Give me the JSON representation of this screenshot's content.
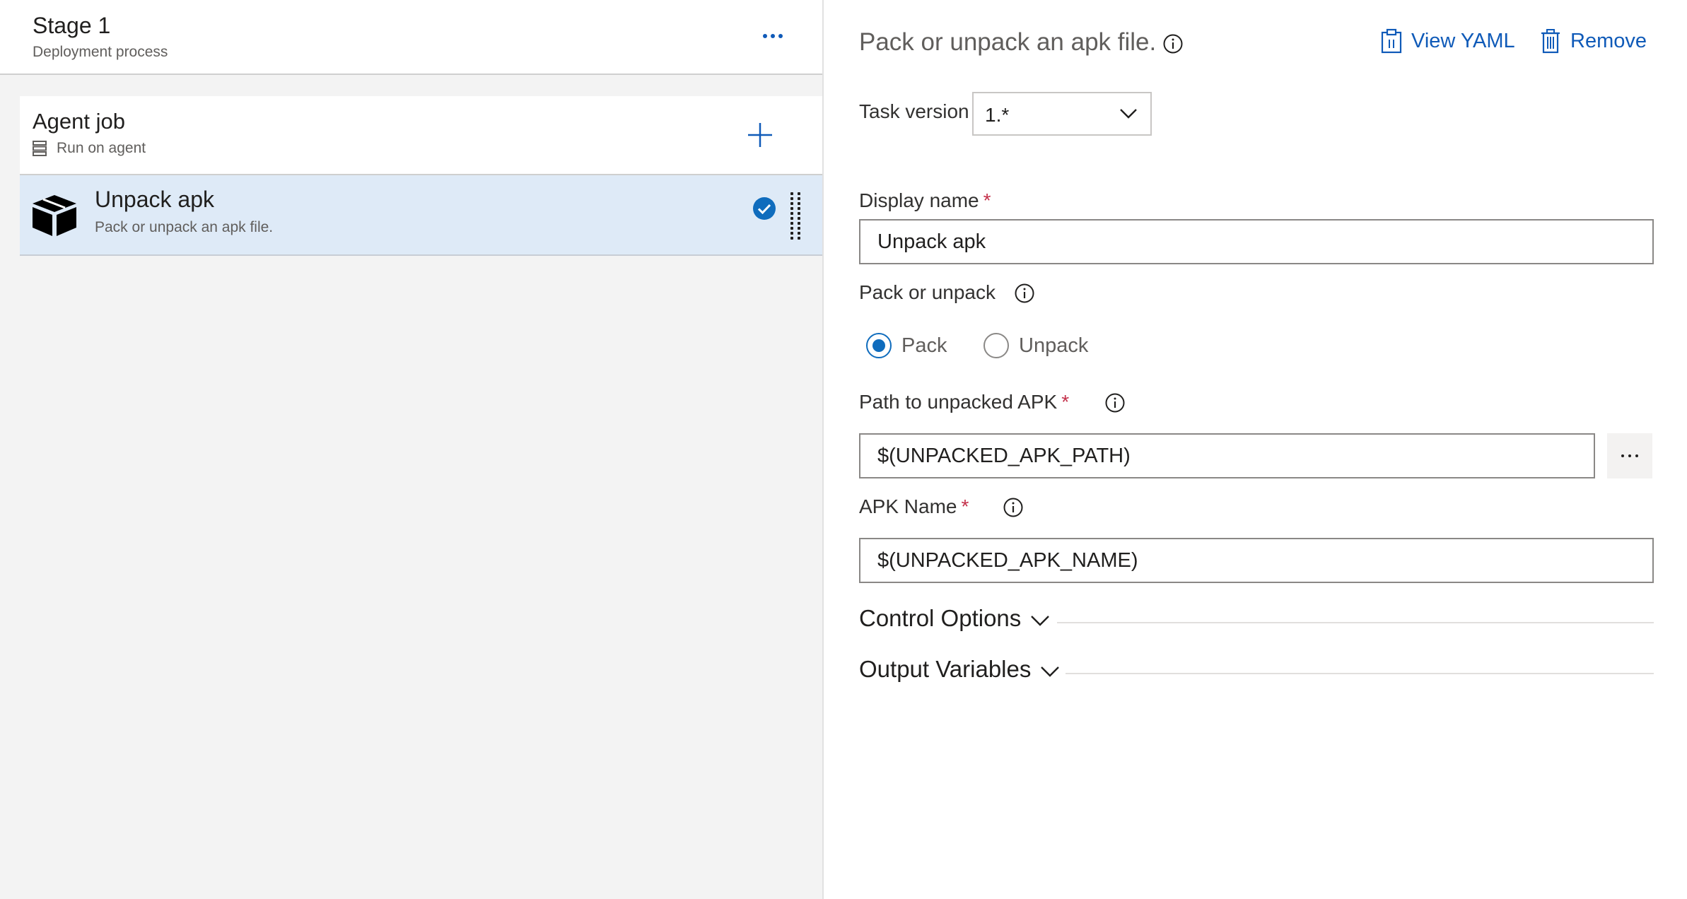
{
  "stage": {
    "title": "Stage 1",
    "subtitle": "Deployment process"
  },
  "agent_job": {
    "title": "Agent job",
    "subtitle": "Run on agent"
  },
  "task": {
    "title": "Unpack apk",
    "subtitle": "Pack or unpack an apk file."
  },
  "details": {
    "title": "Pack or unpack an apk file.",
    "view_yaml": "View YAML",
    "remove": "Remove",
    "task_version_label": "Task version",
    "task_version_value": "1.*",
    "display_name_label": "Display name",
    "display_name_value": "Unpack apk",
    "pack_or_unpack_label": "Pack or unpack",
    "radio_pack": "Pack",
    "radio_unpack": "Unpack",
    "path_label": "Path to unpacked APK",
    "path_value": "$(UNPACKED_APK_PATH)",
    "apk_name_label": "APK Name",
    "apk_name_value": "$(UNPACKED_APK_NAME)",
    "control_options": "Control Options",
    "output_variables": "Output Variables",
    "required_marker": "*"
  },
  "colors": {
    "accent": "#0f5ab8",
    "selected_row": "#deeaf7",
    "required": "#c4314b"
  }
}
